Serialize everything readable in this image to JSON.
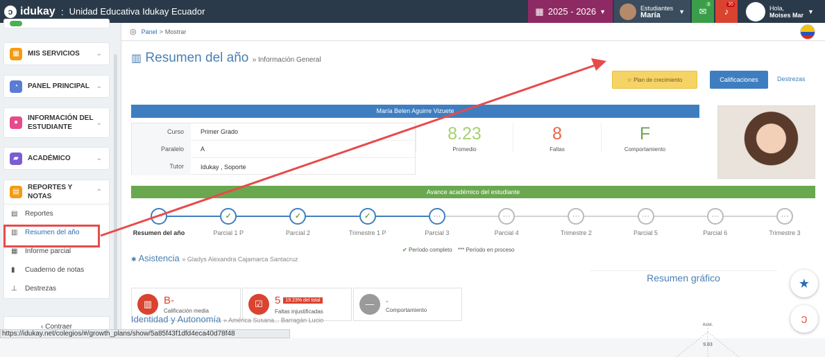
{
  "topbar": {
    "logo": "idukay",
    "separator": ":",
    "school": "Unidad Educativa Idukay Ecuador",
    "year": "2025 - 2026",
    "students_label": "Estudiantes",
    "students_name": "María",
    "msg_count": "3",
    "alert_count": "35",
    "greeting": "Hola,",
    "user_name": "Moises Mar"
  },
  "sidebar": {
    "items": [
      {
        "label": "MIS SERVICIOS",
        "color": "#f39c12"
      },
      {
        "label": "PANEL PRINCIPAL",
        "color": "#5b7bd5"
      },
      {
        "label": "INFORMACIÓN DEL ESTUDIANTE",
        "color": "#e84a8a"
      },
      {
        "label": "ACADÉMICO",
        "color": "#7a5cd5"
      },
      {
        "label": "REPORTES Y NOTAS",
        "color": "#f39c12"
      }
    ],
    "sub_items": [
      "Reportes",
      "Resumen del año",
      "Informe parcial",
      "Cuaderno de notas",
      "Destrezas"
    ],
    "collapse": "Contraer"
  },
  "breadcrumb": {
    "panel": "Panel",
    "separator": ">",
    "current": "Mostrar"
  },
  "header": {
    "title": "Resumen del año",
    "subtitle": "» Información General",
    "plan_button": "Plan de crecimiento",
    "calif_button": "Calificaciones",
    "destrezas_link": "Destrezas"
  },
  "student": {
    "name": "María Belen Aguirre Vizuete",
    "info": [
      {
        "key": "Curso",
        "value": "Primer Grado"
      },
      {
        "key": "Paralelo",
        "value": "A"
      },
      {
        "key": "Tutor",
        "value": "Idukay , Soporte"
      }
    ],
    "stats": [
      {
        "value": "8.23",
        "label": "Promedio",
        "color": "#a6d16f"
      },
      {
        "value": "8",
        "label": "Faltas",
        "color": "#e8664a"
      },
      {
        "value": "F",
        "label": "Comportamiento",
        "color": "#6aa84f"
      }
    ]
  },
  "progress": {
    "title": "Avance académico del estudiante",
    "steps": [
      "Resumen del año",
      "Parcial 1 P",
      "Parcial 2",
      "Trimestre 1 P",
      "Parcial 3",
      "Parcial 4",
      "Trimestre 2",
      "Parcial 5",
      "Parcial 6",
      "Trimestre 3"
    ],
    "legend_complete": "Período completo",
    "legend_inprocess": "*** Período en proceso"
  },
  "asistencia": {
    "title": "Asistencia",
    "teacher": "» Gladys Alexandra Cajamarca Santacruz",
    "cards": [
      {
        "value": "B-",
        "label": "Calificación media",
        "badge": ""
      },
      {
        "value": "5",
        "label": "Faltas injustificadas",
        "badge": "19.23% del total"
      },
      {
        "value": "-",
        "label": "Comportamiento",
        "badge": ""
      }
    ]
  },
  "identidad": {
    "title": "Identidad y Autonomía",
    "teacher": "» América Susana... Barragán Lucio"
  },
  "resumen_grafico": {
    "title": "Resumen gráfico",
    "axis_label": "Asist.",
    "value_label": "9.83"
  },
  "status_url": "https://idukay.net/colegios/#/growth_plans/show/5a85f43f1dfd4eca40d78f48"
}
